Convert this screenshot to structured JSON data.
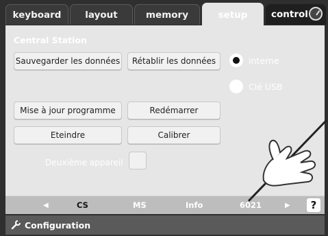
{
  "tabs": [
    {
      "label": "keyboard",
      "active": false
    },
    {
      "label": "layout",
      "active": false
    },
    {
      "label": "memory",
      "active": false
    },
    {
      "label": "setup",
      "active": true
    }
  ],
  "control_tab": {
    "label": "control"
  },
  "section": {
    "title": "Central Station"
  },
  "buttons": {
    "save": "Sauvegarder les données",
    "restore": "Rétablir les données",
    "update": "Mise à jour programme",
    "restart": "Redémarrer",
    "shutdown": "Eteindre",
    "calibrate": "Calibrer"
  },
  "storage": {
    "options": [
      {
        "label": "interne",
        "selected": true
      },
      {
        "label": "Clé USB",
        "selected": false
      }
    ]
  },
  "second_device": {
    "label": "Deuxième appareil",
    "checked": false
  },
  "nav": {
    "items": [
      "CS",
      "MS",
      "Info",
      "6021"
    ],
    "help": "?"
  },
  "footer": {
    "label": "Configuration"
  }
}
